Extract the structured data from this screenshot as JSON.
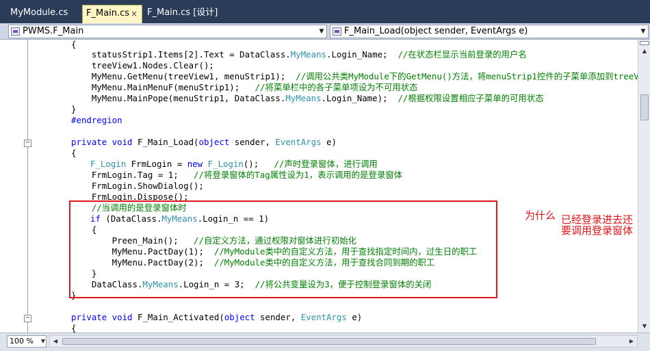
{
  "tabs": [
    {
      "label": "MyModule.cs",
      "active": false
    },
    {
      "label": "F_Main.cs",
      "active": true,
      "close": "×"
    },
    {
      "label": "F_Main.cs [设计]",
      "active": false
    }
  ],
  "nav": {
    "class_combo": "PWMS.F_Main",
    "member_combo": "F_Main_Load(object sender, EventArgs e)"
  },
  "code": {
    "l1": "{",
    "l2_a": "    statusStrip1.Items[2].Text = DataClass.",
    "l2_b": "MyMeans",
    "l2_c": ".Login_Name;  ",
    "l2_d": "//在状态栏显示当前登录的用户名",
    "l3": "    treeView1.Nodes.Clear();",
    "l4_a": "    MyMenu.GetMenu(treeView1, menuStrip1);  ",
    "l4_b": "//调用公共类MyModule下的GetMenu()方法，将menuStrip1控件的子菜单添加到treeView",
    "l5_a": "    MyMenu.MainMenuF(menuStrip1);   ",
    "l5_b": "//将菜单栏中的各子菜单项设为不可用状态",
    "l6_a": "    MyMenu.MainPope(menuStrip1, DataClass.",
    "l6_b": "MyMeans",
    "l6_c": ".Login_Name);  ",
    "l6_d": "//根据权限设置相应子菜单的可用状态",
    "l7": "}",
    "l8": "#endregion",
    "l9_a": "private void ",
    "l9_b": "F_Main_Load(",
    "l9_c": "object ",
    "l9_d": "sender, ",
    "l9_e": "EventArgs",
    "l9_f": " e)",
    "l10": "{",
    "l11_a": "F_Login",
    "l11_b": " FrmLogin = ",
    "l11_c": "new ",
    "l11_d": "F_Login",
    "l11_e": "();   ",
    "l11_f": "//声时登录窗体，进行调用",
    "l12_a": "    FrmLogin.Tag = 1;   ",
    "l12_b": "//将登录窗体的Tag属性设为1，表示调用的是登录窗体",
    "l13": "    FrmLogin.ShowDialog();",
    "l14": "    FrmLogin.Dispose();",
    "l15": "    //当调用的是登录窗体时",
    "l16_a": "if ",
    "l16_b": "(DataClass.",
    "l16_c": "MyMeans",
    "l16_d": ".Login_n == 1)",
    "l17": "    {",
    "l18_a": "        Preen_Main();   ",
    "l18_b": "//自定义方法，通过权限对窗体进行初始化",
    "l19_a": "        MyMenu.PactDay(1);  ",
    "l19_b": "//MyModule类中的自定义方法，用于查找指定时间内，过生日的职工",
    "l20_a": "        MyMenu.PactDay(2);  ",
    "l20_b": "//MyModule类中的自定义方法，用于查找合同到期的职工",
    "l21": "    }",
    "l22_a": "    DataClass.",
    "l22_b": "MyMeans",
    "l22_c": ".Login_n = 3;  ",
    "l22_d": "//将公共变量设为3，便于控制登录窗体的关闭",
    "l23": "}",
    "l24_a": "private void ",
    "l24_b": "F_Main_Activated(",
    "l24_c": "object ",
    "l24_d": "sender, ",
    "l24_e": "EventArgs",
    "l24_f": " e)",
    "l25": "{"
  },
  "annotations": {
    "why": "为什么",
    "line1": "已经登录进去还",
    "line2": "要调用登录窗体"
  },
  "bottom": {
    "zoom": "100 %"
  },
  "colors": {
    "annotation": "#e0151c",
    "keyword": "#0000ff",
    "type": "#2b91af",
    "comment": "#008000"
  }
}
